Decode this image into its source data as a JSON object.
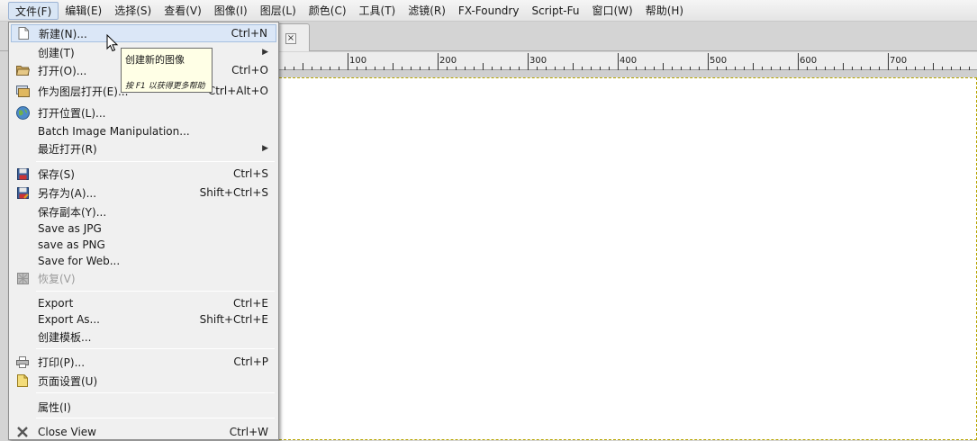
{
  "menubar": {
    "items": [
      {
        "label": "文件(F)"
      },
      {
        "label": "编辑(E)"
      },
      {
        "label": "选择(S)"
      },
      {
        "label": "查看(V)"
      },
      {
        "label": "图像(I)"
      },
      {
        "label": "图层(L)"
      },
      {
        "label": "颜色(C)"
      },
      {
        "label": "工具(T)"
      },
      {
        "label": "滤镜(R)"
      },
      {
        "label": "FX-Foundry"
      },
      {
        "label": "Script-Fu"
      },
      {
        "label": "窗口(W)"
      },
      {
        "label": "帮助(H)"
      }
    ]
  },
  "tab": {
    "close_icon": "×"
  },
  "ruler": {
    "labels": [
      "100",
      "200",
      "300",
      "400",
      "500",
      "600",
      "700"
    ]
  },
  "file_menu": {
    "items": [
      {
        "label": "新建(N)...",
        "shortcut": "Ctrl+N",
        "icon": "new-document-icon"
      },
      {
        "label": "创建(T)",
        "shortcut": "",
        "icon": ""
      },
      {
        "label": "打开(O)...",
        "shortcut": "Ctrl+O",
        "icon": "folder-open-icon"
      },
      {
        "label": "作为图层打开(E)...",
        "shortcut": "Ctrl+Alt+O",
        "icon": "open-as-layers-icon"
      },
      {
        "label": "打开位置(L)...",
        "shortcut": "",
        "icon": "globe-icon"
      },
      {
        "label": "Batch Image Manipulation...",
        "shortcut": "",
        "icon": ""
      },
      {
        "label": "最近打开(R)",
        "shortcut": "",
        "icon": ""
      },
      {
        "label": "保存(S)",
        "shortcut": "Ctrl+S",
        "icon": "save-icon"
      },
      {
        "label": "另存为(A)...",
        "shortcut": "Shift+Ctrl+S",
        "icon": "save-as-icon"
      },
      {
        "label": "保存副本(Y)...",
        "shortcut": "",
        "icon": ""
      },
      {
        "label": "Save as JPG",
        "shortcut": "",
        "icon": ""
      },
      {
        "label": "save as PNG",
        "shortcut": "",
        "icon": ""
      },
      {
        "label": "Save for Web...",
        "shortcut": "",
        "icon": ""
      },
      {
        "label": "恢复(V)",
        "shortcut": "",
        "icon": "revert-icon"
      },
      {
        "label": "Export",
        "shortcut": "Ctrl+E",
        "icon": ""
      },
      {
        "label": "Export As...",
        "shortcut": "Shift+Ctrl+E",
        "icon": ""
      },
      {
        "label": "创建模板...",
        "shortcut": "",
        "icon": ""
      },
      {
        "label": "打印(P)...",
        "shortcut": "Ctrl+P",
        "icon": "printer-icon"
      },
      {
        "label": "页面设置(U)",
        "shortcut": "",
        "icon": "page-setup-icon"
      },
      {
        "label": "属性(I)",
        "shortcut": "",
        "icon": ""
      },
      {
        "label": "Close View",
        "shortcut": "Ctrl+W",
        "icon": "close-view-icon"
      }
    ]
  },
  "tooltip": {
    "title": "创建新的图像",
    "hint": "按 F1 以获得更多帮助"
  },
  "colors": {
    "menu_highlight": "#dbe7f7",
    "tooltip_bg": "#ffffe6",
    "canvas_border": "#b6a400"
  }
}
